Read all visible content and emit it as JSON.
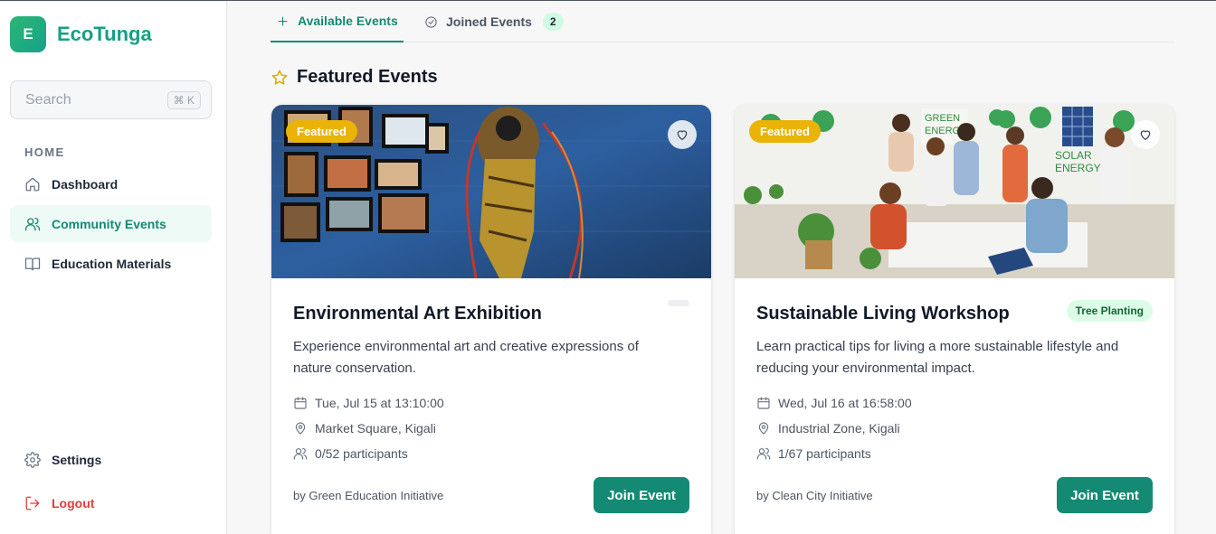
{
  "app": {
    "logo_letter": "E",
    "name": "EcoTunga"
  },
  "search": {
    "placeholder": "Search",
    "shortcut": "⌘ K"
  },
  "sidebar": {
    "section_label": "HOME",
    "items": [
      {
        "label": "Dashboard",
        "icon": "home-icon"
      },
      {
        "label": "Community Events",
        "icon": "users-icon",
        "active": true
      },
      {
        "label": "Education Materials",
        "icon": "book-icon"
      }
    ],
    "settings_label": "Settings",
    "logout_label": "Logout"
  },
  "tabs": [
    {
      "label": "Available Events",
      "icon": "plus-icon",
      "active": true
    },
    {
      "label": "Joined Events",
      "icon": "check-circle-icon",
      "count": "2"
    }
  ],
  "featured": {
    "heading": "Featured Events",
    "icon": "star-icon"
  },
  "events": [
    {
      "badge": "Featured",
      "title": "Environmental Art Exhibition",
      "tag": "",
      "description": "Experience environmental art and creative expressions of nature conservation.",
      "date": "Tue, Jul 15 at 13:10:00",
      "location": "Market Square, Kigali",
      "participants": "0/52 participants",
      "organizer": "by Green Education Initiative",
      "join_label": "Join Event"
    },
    {
      "badge": "Featured",
      "title": "Sustainable Living Workshop",
      "tag": "Tree Planting",
      "description": "Learn practical tips for living a more sustainable lifestyle and reducing your environmental impact.",
      "date": "Wed, Jul 16 at 16:58:00",
      "location": "Industrial Zone, Kigali",
      "participants": "1/67 participants",
      "organizer": "by Clean City Initiative",
      "join_label": "Join Event"
    }
  ],
  "colors": {
    "accent": "#148a74",
    "brand": "#16a085",
    "featured_badge": "#eab308",
    "danger": "#e23b3b"
  }
}
